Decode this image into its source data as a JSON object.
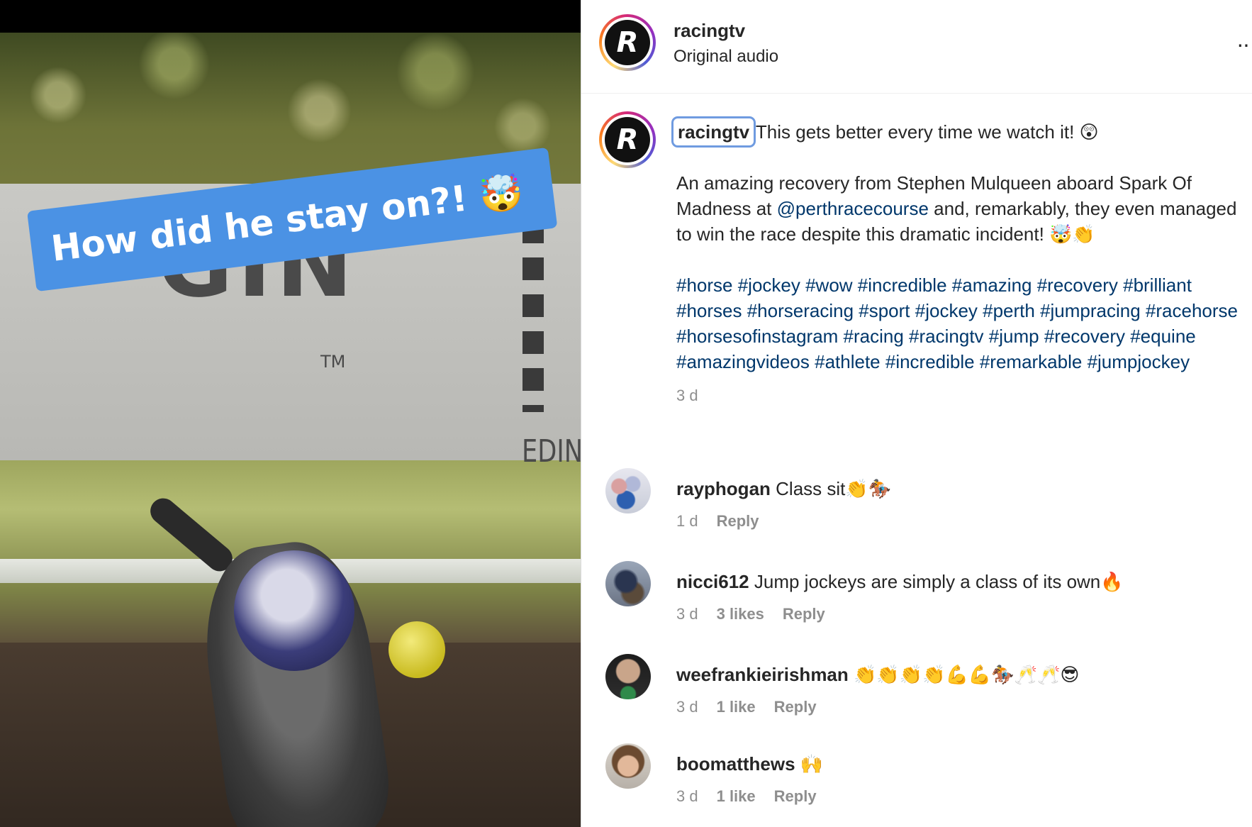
{
  "video": {
    "caption": "How did he stay on?! 🤯",
    "banner_text": "GIN",
    "banner_tm": "TM",
    "banner_edin": "EDIN"
  },
  "header": {
    "username": "racingtv",
    "audio": "Original audio",
    "more": "··"
  },
  "post": {
    "username": "racingtv",
    "first_line": "This gets better every time we watch it! 😲",
    "para_before_mention": "An amazing recovery from Stephen Mulqueen aboard Spark Of Madness at ",
    "mention": "@perthracecourse",
    "para_after_mention": " and, remarkably, they even managed to win the race despite this dramatic incident! 🤯👏",
    "hashtags": "#horse #jockey #wow #incredible #amazing #recovery #brilliant #horses #horseracing #sport #jockey #perth #jumpracing #racehorse #horsesofinstagram #racing #racingtv #jump #recovery #equine #amazingvideos #athlete #incredible #remarkable #jumpjockey",
    "time": "3 d"
  },
  "comments": [
    {
      "username": "rayphogan",
      "text": "Class sit👏🏇",
      "time": "1 d",
      "likes": "",
      "reply": "Reply"
    },
    {
      "username": "nicci612",
      "text": "Jump jockeys are simply a class of its own🔥",
      "time": "3 d",
      "likes": "3 likes",
      "reply": "Reply"
    },
    {
      "username": "weefrankieirishman",
      "text": "👏👏👏👏💪💪🏇🥂🥂😎",
      "time": "3 d",
      "likes": "1 like",
      "reply": "Reply"
    },
    {
      "username": "boomatthews",
      "text": "🙌",
      "time": "3 d",
      "likes": "1 like",
      "reply": "Reply"
    }
  ],
  "colors": {
    "link": "#00376b",
    "caption_bg": "#4b92e4",
    "focus_ring": "#6f9be0",
    "meta_gray": "#8e8e8e"
  }
}
